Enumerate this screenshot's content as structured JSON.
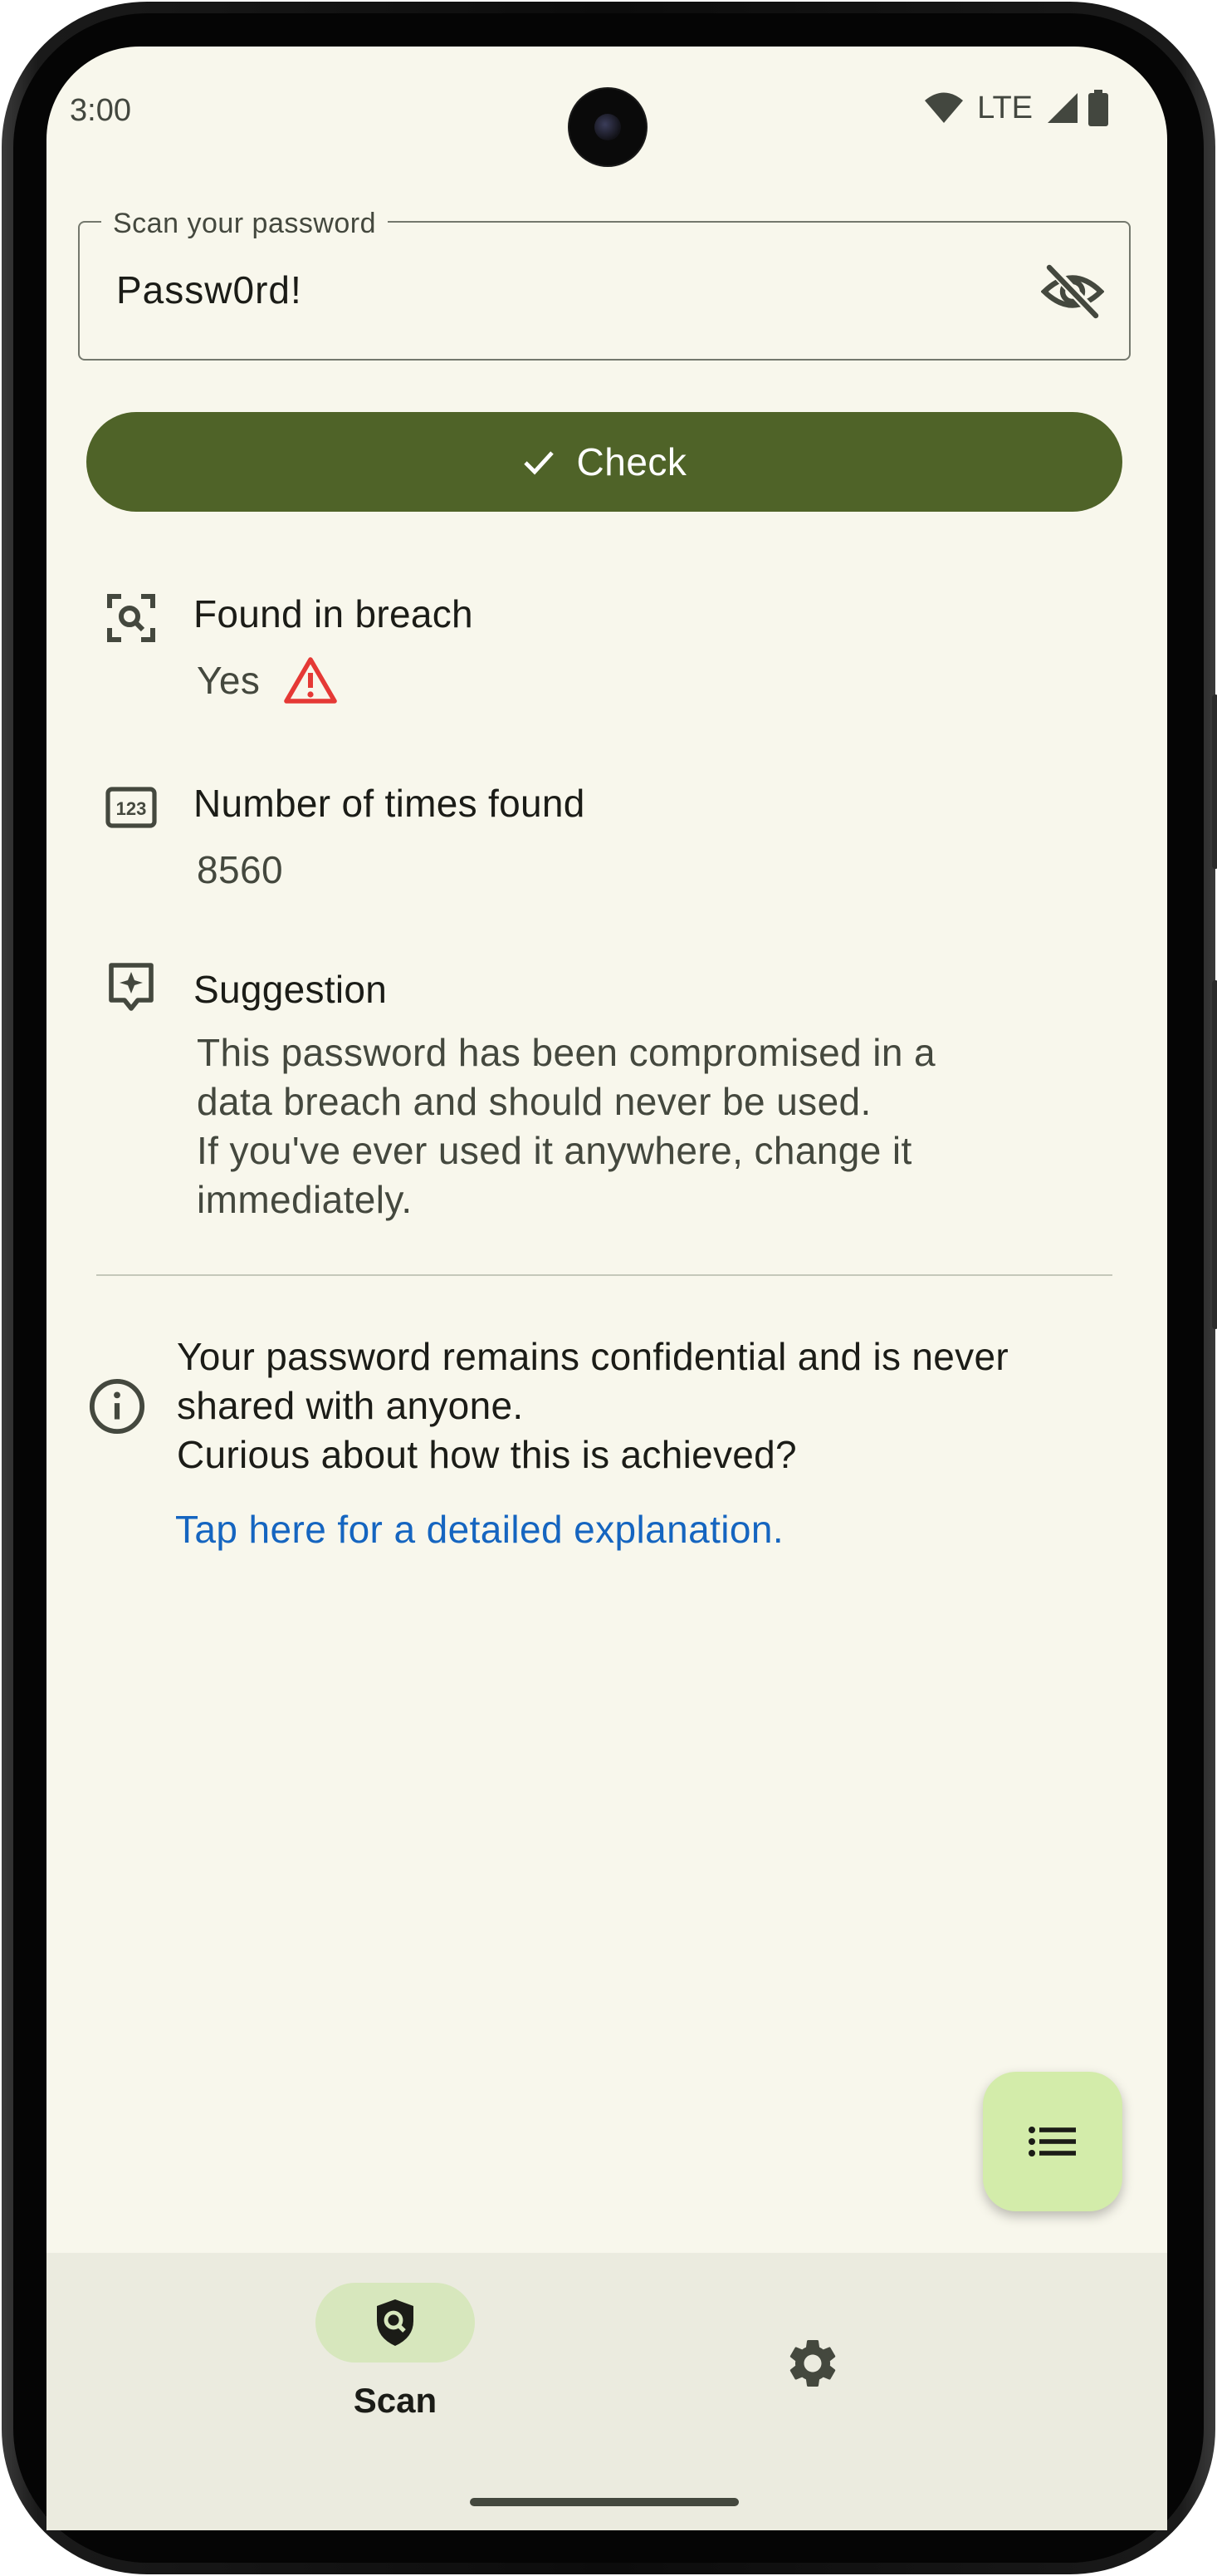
{
  "status_bar": {
    "time": "3:00",
    "network": "LTE",
    "icons": [
      "wifi-icon",
      "cell-signal-icon",
      "battery-icon"
    ]
  },
  "password": {
    "label": "Scan your password",
    "value": "Passw0rd!",
    "visibility_icon": "eye-off-icon"
  },
  "check_button": {
    "label": "Check",
    "icon": "check-icon",
    "color": "#4f6328"
  },
  "results": {
    "breach": {
      "title": "Found in breach",
      "value": "Yes",
      "icon": "scan-search-icon",
      "warning_icon": "warning-icon",
      "warning_color": "#e53935"
    },
    "count": {
      "title": "Number of times found",
      "value": "8560",
      "icon": "number-123-icon"
    },
    "suggestion": {
      "title": "Suggestion",
      "icon": "sparkle-note-icon",
      "lines": [
        "This password has been compromised in a",
        "data breach and should never be used.",
        "If you've ever used it anywhere, change it",
        "immediately."
      ]
    }
  },
  "info": {
    "icon": "info-icon",
    "lines": [
      "Your password remains confidential and is never",
      "shared with anyone.",
      "Curious about how this is achieved?"
    ],
    "link": "Tap here for a detailed explanation.",
    "link_color": "#1565c0"
  },
  "fab": {
    "icon": "list-icon",
    "color": "#d3ecaa"
  },
  "bottom_nav": {
    "items": [
      {
        "label": "Scan",
        "icon": "shield-search-icon",
        "selected": true
      },
      {
        "label": "",
        "icon": "settings-gear-icon",
        "selected": false
      }
    ]
  }
}
